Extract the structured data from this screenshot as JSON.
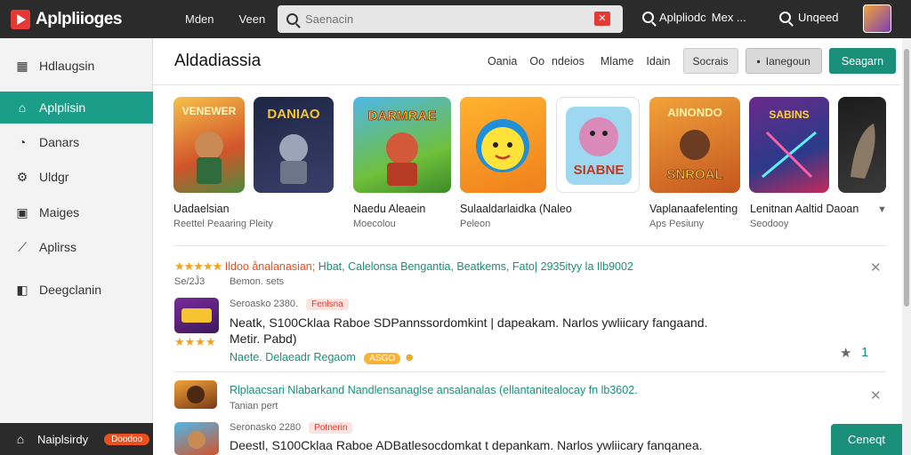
{
  "app": {
    "title": "Aplpliioges"
  },
  "topnav": [
    "Mden",
    "Veen"
  ],
  "search": {
    "placeholder": "Saenacin",
    "value": ""
  },
  "top_right": {
    "search_label": "Aplpliodc",
    "more": "Mex ...",
    "user_label": "Unqeed"
  },
  "sidebar": {
    "items": [
      {
        "label": "Hdlaugsin",
        "icon": "apps-grid-icon"
      },
      {
        "label": "Aplplisin",
        "icon": "home-icon",
        "active": true
      },
      {
        "label": "Danars",
        "icon": "apps-icon"
      },
      {
        "label": "Uldgr",
        "icon": "gear-icon"
      },
      {
        "label": "Maiges",
        "icon": "image-icon"
      },
      {
        "label": "Aplirss",
        "icon": "chart-icon"
      },
      {
        "label": "Deegclanin",
        "icon": "layout-icon"
      }
    ],
    "bottom": {
      "label": "Naiplsirdy",
      "badge": "Doodoo"
    }
  },
  "main": {
    "title": "Aldadiassia",
    "filters": [
      "Oania",
      "Oo",
      "ndeios",
      "Mlame",
      "Idain"
    ],
    "btn_grey": "Socrais",
    "btn_grey2": "Ianegoun",
    "btn_green": "Seagarn"
  },
  "apps": [
    {
      "label": "Uadaelsian",
      "sub": "Reettel Peaaring Pleity",
      "tile_text": "VENEWER"
    },
    {
      "label": "",
      "sub": "",
      "tile_text": "DANIAO"
    },
    {
      "label": "Naedu Aleaein",
      "sub": "Moecolou",
      "tile_text": "DARMRAE"
    },
    {
      "label": "Sulaaldarlaidka (Naleo",
      "sub": "Peleon",
      "tile_text": ""
    },
    {
      "label": "",
      "sub": "",
      "tile_text": "SIABNE"
    },
    {
      "label": "Vaplanaafelenting",
      "sub": "Aps Pesiuny",
      "tile_text": "SNROAL"
    },
    {
      "label": "Lenitnan Aaltid Daoan",
      "sub": "Seodooy",
      "tile_text": "SABINS"
    },
    {
      "label": "",
      "sub": "",
      "tile_text": ""
    }
  ],
  "reviews": [
    {
      "stars": "★★★★★",
      "head_orange": "Ildoo ånalanasian;",
      "head_green": "Hbat, Calelonsa Bengantia, Beatkems, Fato| 2935ityy la Ilb9002",
      "meta_left": "Se/2Ĵ3",
      "meta_right": "Bemon. sets",
      "sub_meta": "Seroasko 2380.",
      "tag": "Fenlsna",
      "body1": "Neatk, S100Cklaa Raboe SDPannssordomkint | dapeakam. Narlos ywliicary fangaand.",
      "body2": "Metir. Pabd)",
      "link": "Naete. Delaeadr Regaom",
      "pill": "ASGO",
      "count": "1",
      "thumb_stars": "★★★★"
    },
    {
      "head_green": "Rlplaacsari Nlabarkand Nandlensanaglse ansalanalas (ellantanitealocay fn lb3602.",
      "meta_right": "Tanian pert",
      "sub_meta": "Seronasko 2280",
      "tag": "Potnerin",
      "body1": "Deestl, S100Cklaa Raboe ADBatlesocdomkat t depankam. Narlos ywliicary fanqanea."
    }
  ],
  "footer": {
    "button": "Ceneqt"
  }
}
